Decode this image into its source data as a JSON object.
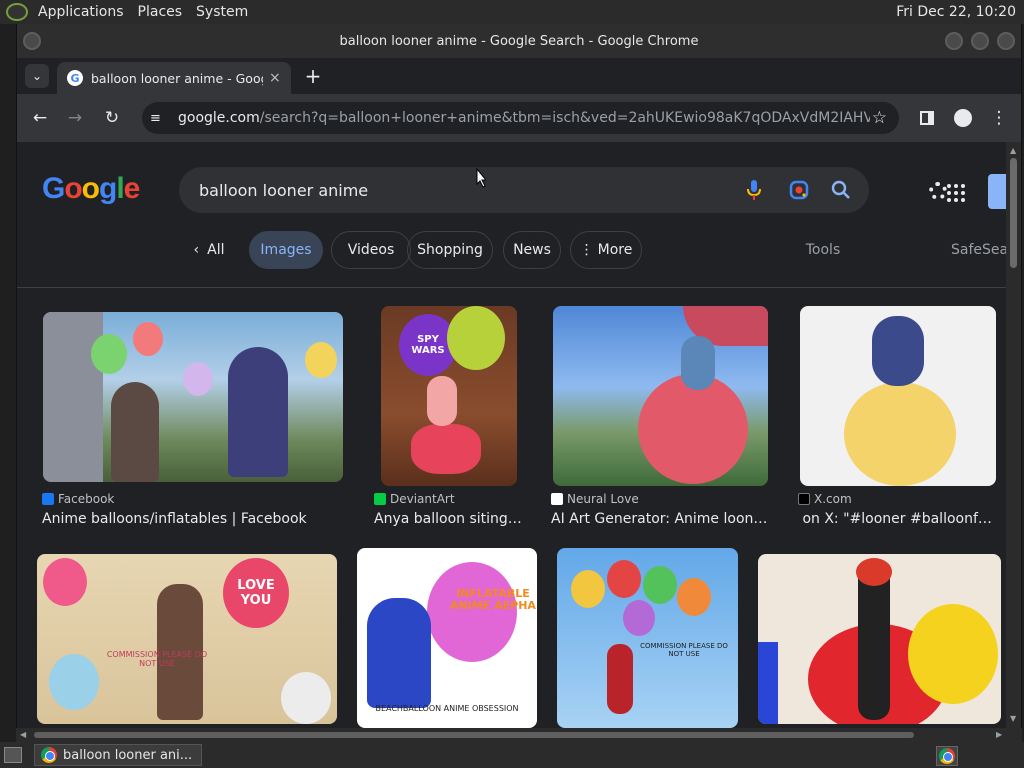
{
  "desktop_panel": {
    "menus": [
      "Applications",
      "Places",
      "System"
    ],
    "clock": "Fri Dec 22, 10:20"
  },
  "window": {
    "title": "balloon looner anime - Google Search - Google Chrome"
  },
  "browser": {
    "tab_title": "balloon looner anime - Google Search",
    "url_host": "google.com",
    "url_path": "/search?q=balloon+looner+anime&tbm=isch&ved=2ahUKEwio98aK7qODAxVdM2IAHV1VBB8Q2-..."
  },
  "google": {
    "logo_letters": [
      {
        "ch": "G",
        "color": "#4285f4"
      },
      {
        "ch": "o",
        "color": "#ea4335"
      },
      {
        "ch": "o",
        "color": "#fbbc05"
      },
      {
        "ch": "g",
        "color": "#4285f4"
      },
      {
        "ch": "l",
        "color": "#34a853"
      },
      {
        "ch": "e",
        "color": "#ea4335"
      }
    ],
    "query": "balloon looner anime",
    "filters": {
      "all": "All",
      "images": "Images",
      "videos": "Videos",
      "shopping": "Shopping",
      "news": "News",
      "more": "More",
      "tools": "Tools",
      "safesearch": "SafeSearch"
    },
    "results": [
      {
        "source": "Facebook",
        "title": "Anime balloons/inflatables | Facebook",
        "icon_color": "#1877f2"
      },
      {
        "source": "DeviantArt",
        "title": "Anya balloon siting b...",
        "icon_color": "#05cc47"
      },
      {
        "source": "Neural Love",
        "title": "AI Art Generator: Anime looner g...",
        "icon_color": "#ffffff"
      },
      {
        "source": "X.com",
        "title": " on X: \"#looner #balloonfetish...",
        "icon_color": "#000000"
      }
    ],
    "image_text": {
      "spy_wars": "SPY WARS",
      "love_you": "LOVE YOU",
      "inflatable": "INFLATABLE ANIME AEPHA",
      "obsession": "BEACHBALLOON ANIME OBSESSION",
      "commission": "COMMISSION PLEASE DO NOT USE"
    }
  },
  "taskbar": {
    "item": "balloon looner ani..."
  },
  "colors": {
    "page_bg": "#202124",
    "chip_selected": "#394457",
    "accent_blue": "#8ab4f8"
  }
}
